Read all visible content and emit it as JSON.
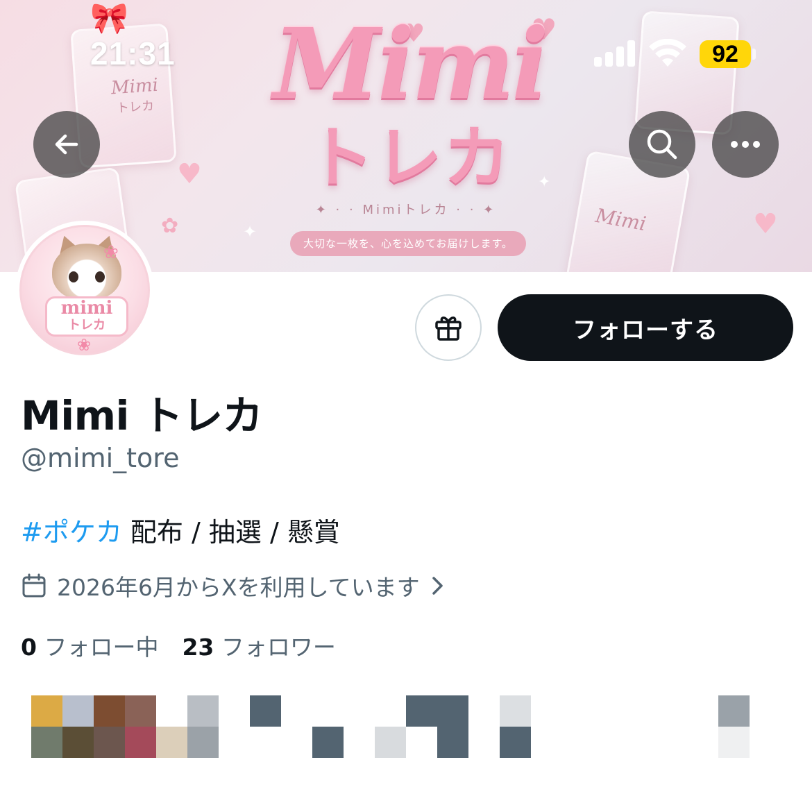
{
  "status_bar": {
    "time": "21:31",
    "battery_level": "92",
    "battery_color": "#ffd60a"
  },
  "banner": {
    "logo_main": "Mimi",
    "logo_sub": "トレカ",
    "tagline": "Mimiトレカ",
    "pill_text": "大切な一枚を、心を込めてお届けします。",
    "card_text": "Mimi",
    "card_subtext": "トレカ"
  },
  "nav": {
    "back_icon": "arrow-left-icon",
    "search_icon": "search-icon",
    "more_icon": "more-horizontal-icon"
  },
  "avatar": {
    "plate_line1": "mimi",
    "plate_line2": "トレカ"
  },
  "actions": {
    "gift_icon": "gift-icon",
    "follow_label": "フォローする"
  },
  "profile": {
    "display_name": "Mimi トレカ",
    "handle": "@mimi_tore",
    "bio_hashtag": "#ポケカ",
    "bio_text": " 配布 / 抽選 / 懸賞",
    "joined": "2026年6月からXを利用しています",
    "following_count": "0",
    "following_label": "フォロー中",
    "followers_count": "23",
    "followers_label": "フォロワー"
  },
  "colors": {
    "accent_link": "#1d9bf0",
    "secondary_text": "#536471",
    "follow_button_bg": "#0f1419",
    "banner_pink": "#f49bb8"
  }
}
